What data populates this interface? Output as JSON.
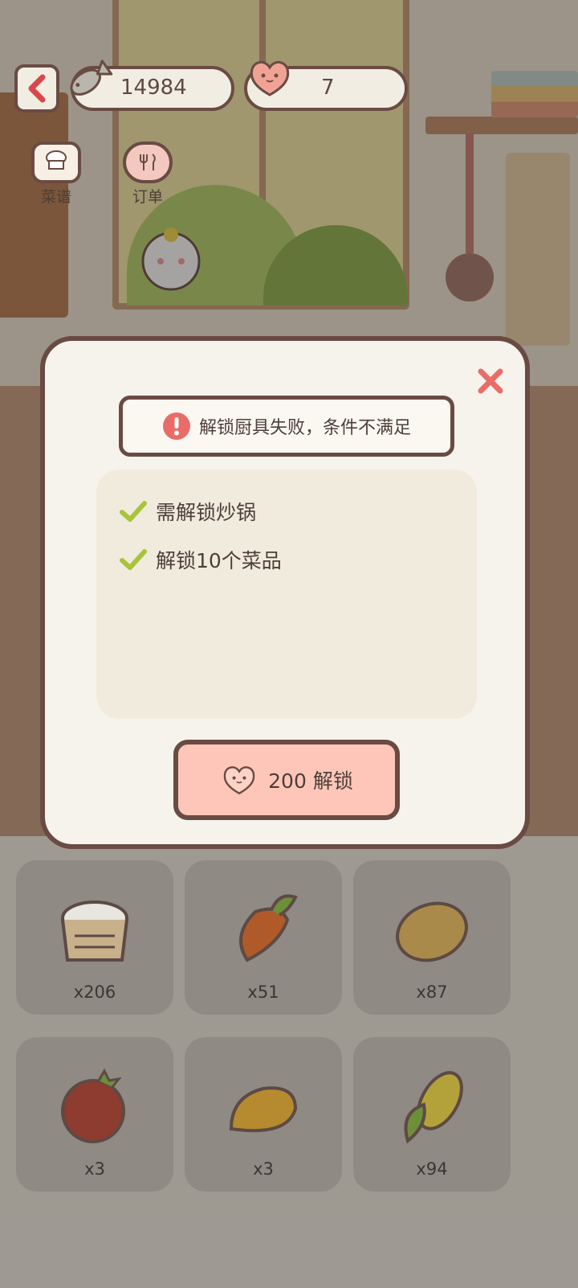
{
  "hud": {
    "coins": "14984",
    "hearts": "7",
    "menu": [
      {
        "label": "菜谱",
        "icon": "recipe-book-icon"
      },
      {
        "label": "订单",
        "icon": "order-cat-icon"
      }
    ]
  },
  "modal": {
    "alert_text": "解锁厨具失败，条件不满足",
    "requirements": [
      {
        "text": "需解锁炒锅",
        "met": true
      },
      {
        "text": "解锁10个菜品",
        "met": true
      }
    ],
    "unlock_button": {
      "cost_label": "200 解锁",
      "icon": "heart-currency-icon"
    }
  },
  "inventory": [
    {
      "item": "flour-icon",
      "qty": "x206"
    },
    {
      "item": "carrot-icon",
      "qty": "x51"
    },
    {
      "item": "potato-icon",
      "qty": "x87"
    },
    {
      "item": "tomato-icon",
      "qty": "x3"
    },
    {
      "item": "mango-icon",
      "qty": "x3"
    },
    {
      "item": "corn-icon",
      "qty": "x94"
    }
  ],
  "colors": {
    "outline": "#6a4b43",
    "check": "#a9c43a",
    "close": "#e86d68",
    "unlock_button": "#fdc6b8"
  }
}
